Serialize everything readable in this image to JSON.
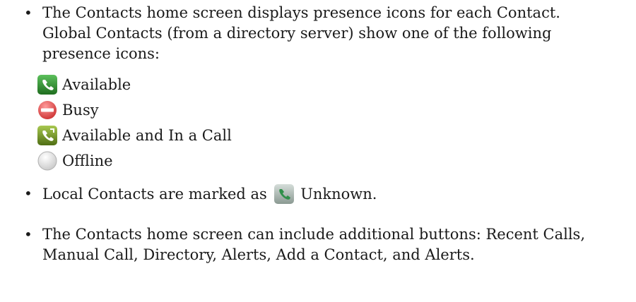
{
  "bullet_symbol": "•",
  "intro": {
    "line1": "The Contacts home screen displays presence icons for each Contact.",
    "line2": "Global Contacts (from a directory server) show one of the following",
    "line3": "presence icons:"
  },
  "presence_icons": [
    {
      "icon": "phone-green-icon",
      "label": "Available"
    },
    {
      "icon": "busy-red-icon",
      "label": "Busy"
    },
    {
      "icon": "phone-in-call-icon",
      "label": "Available and In a Call"
    },
    {
      "icon": "offline-gray-icon",
      "label": "Offline"
    }
  ],
  "local_contacts": {
    "prefix": "Local Contacts are marked as",
    "icon": "phone-gray-icon",
    "suffix": "Unknown."
  },
  "buttons_note": {
    "line1": "The Contacts home screen can include additional buttons: Recent Calls,",
    "line2": "Manual Call, Directory, Alerts, Add a Contact, and Alerts."
  },
  "colors": {
    "available_green": "#2e8b2e",
    "busy_red": "#d83a3a",
    "in_call_olive": "#7a9a2a",
    "offline_gray": "#d9d9d9",
    "unknown_gray": "#a9b6b0"
  }
}
